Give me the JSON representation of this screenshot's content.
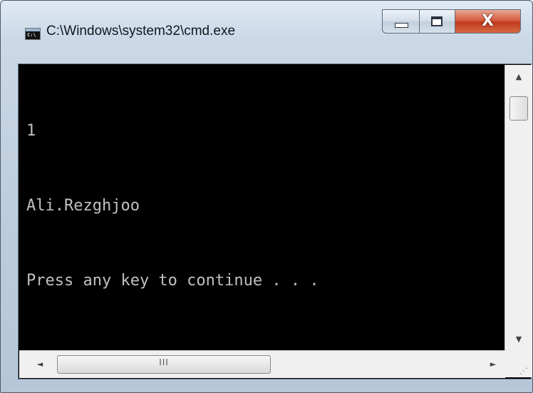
{
  "window": {
    "title": "C:\\Windows\\system32\\cmd.exe",
    "icon_label": "C:\\",
    "controls": {
      "minimize_icon": "minimize-icon",
      "maximize_icon": "maximize-icon",
      "close_glyph": "X"
    }
  },
  "console": {
    "lines": [
      "1",
      "Ali.Rezghjoo",
      "Press any key to continue . . ."
    ]
  },
  "scrollbars": {
    "horizontal_thumb_grip": "III",
    "up_arrow": "▲",
    "down_arrow": "▼",
    "left_arrow": "◄",
    "right_arrow": "►"
  },
  "colors": {
    "console_bg": "#000000",
    "console_text": "#c0c0c0",
    "close_button": "#c8401f"
  }
}
